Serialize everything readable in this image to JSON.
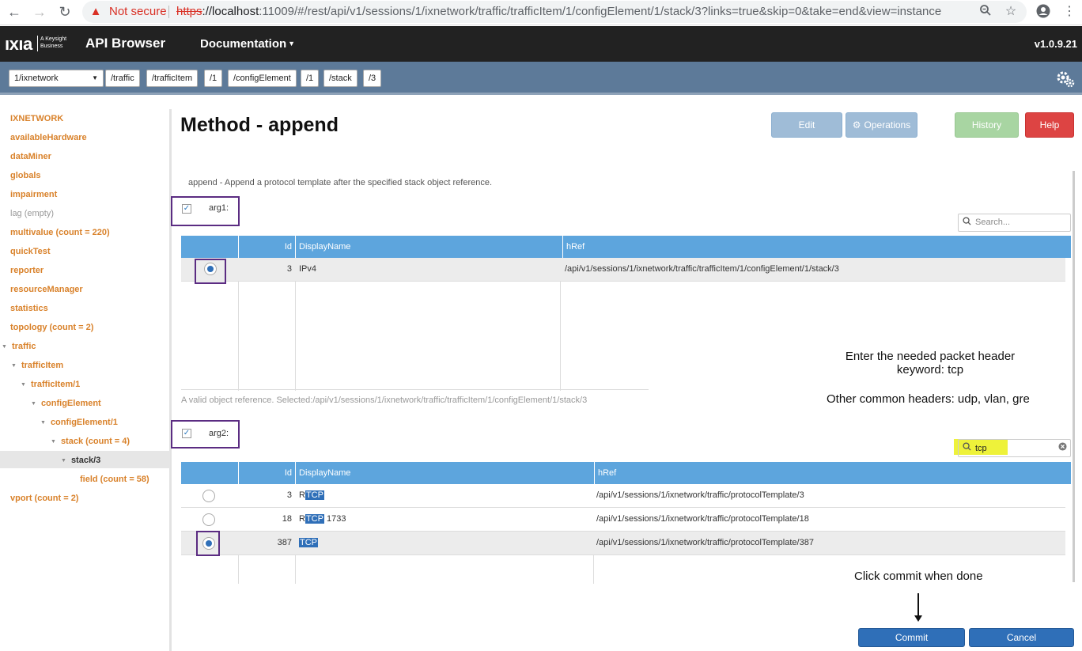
{
  "browser": {
    "back_icon": "←",
    "forward_icon": "→",
    "reload_icon": "↻",
    "security_label": "Not secure",
    "url_scheme": "https",
    "url_host": "://localhost",
    "url_rest": ":11009/#/rest/api/v1/sessions/1/ixnetwork/traffic/trafficItem/1/configElement/1/stack/3?links=true&skip=0&take=end&view=instance"
  },
  "header": {
    "logo": "ıxıa",
    "logo_sub": "A Keysight Business",
    "app_title": "API Browser",
    "doc_menu": "Documentation",
    "version": "v1.0.9.21"
  },
  "breadcrumb": {
    "session": "1/ixnetwork",
    "items": [
      "/traffic",
      "/trafficItem",
      "/1",
      "/configElement",
      "/1",
      "/stack",
      "/3"
    ]
  },
  "sidebar": {
    "items": [
      {
        "label": "IXNETWORK"
      },
      {
        "label": "availableHardware"
      },
      {
        "label": "dataMiner"
      },
      {
        "label": "globals"
      },
      {
        "label": "impairment"
      },
      {
        "label": "lag (empty)"
      },
      {
        "label": "multivalue (count = 220)"
      },
      {
        "label": "quickTest"
      },
      {
        "label": "reporter"
      },
      {
        "label": "resourceManager"
      },
      {
        "label": "statistics"
      },
      {
        "label": "topology (count = 2)"
      },
      {
        "label": "traffic"
      },
      {
        "label": "trafficItem"
      },
      {
        "label": "trafficItem/1"
      },
      {
        "label": "configElement"
      },
      {
        "label": "configElement/1"
      },
      {
        "label": "stack (count = 4)"
      },
      {
        "label": "stack/3"
      },
      {
        "label": "field (count = 58)"
      },
      {
        "label": "vport (count = 2)"
      }
    ]
  },
  "main": {
    "title": "Method - append",
    "buttons": {
      "edit": "Edit",
      "operations": "Operations",
      "history": "History",
      "help": "Help"
    },
    "description": "append - Append a protocol template after the specified stack object reference.",
    "arg1": {
      "label": "arg1:",
      "checked": true,
      "search_placeholder": "Search...",
      "columns": [
        "Id",
        "DisplayName",
        "hRef"
      ],
      "rows": [
        {
          "id": "3",
          "name": "IPv4",
          "href": "/api/v1/sessions/1/ixnetwork/traffic/trafficItem/1/configElement/1/stack/3",
          "selected": true
        }
      ],
      "valid_message": "A valid object reference. Selected:/api/v1/sessions/1/ixnetwork/traffic/trafficItem/1/configElement/1/stack/3"
    },
    "arg2": {
      "label": "arg2:",
      "checked": true,
      "search_value": "tcp",
      "columns": [
        "Id",
        "DisplayName",
        "hRef"
      ],
      "rows": [
        {
          "id": "3",
          "name_prefix": "R",
          "name_hl": "TCP",
          "name_suffix": "",
          "href": "/api/v1/sessions/1/ixnetwork/traffic/protocolTemplate/3",
          "selected": false
        },
        {
          "id": "18",
          "name_prefix": "R",
          "name_hl": "TCP",
          "name_suffix": " 1733",
          "href": "/api/v1/sessions/1/ixnetwork/traffic/protocolTemplate/18",
          "selected": false
        },
        {
          "id": "387",
          "name_prefix": "",
          "name_hl": "TCP",
          "name_suffix": "",
          "href": "/api/v1/sessions/1/ixnetwork/traffic/protocolTemplate/387",
          "selected": true
        }
      ]
    },
    "annotations": {
      "keyword_line1": "Enter the needed packet header",
      "keyword_line2": "keyword: tcp",
      "other_headers": "Other common headers: udp, vlan, gre",
      "commit_hint": "Click commit when done"
    },
    "commit": "Commit",
    "cancel": "Cancel"
  }
}
